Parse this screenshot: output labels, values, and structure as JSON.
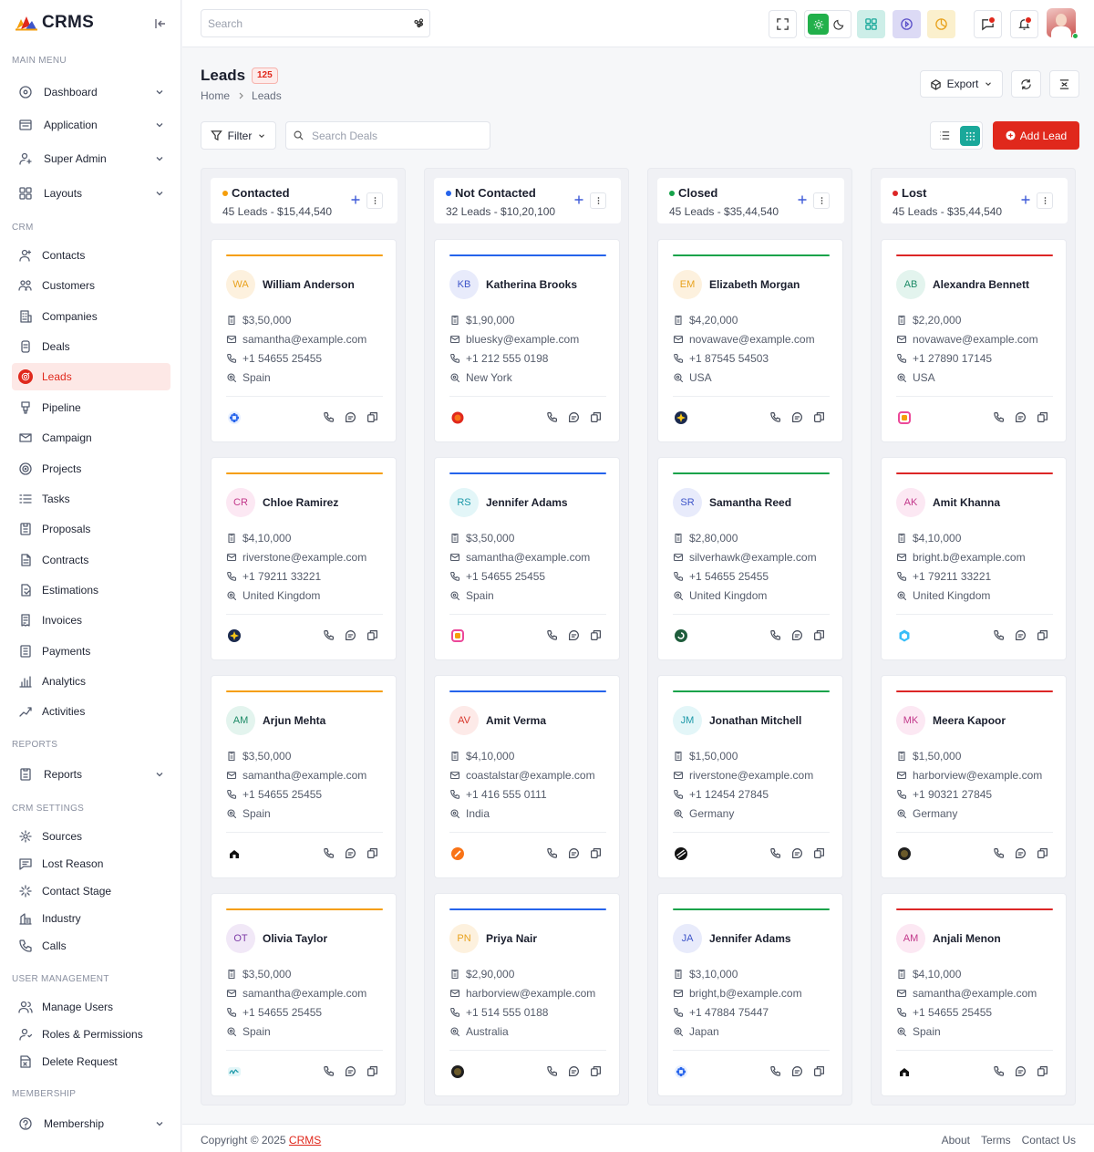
{
  "brand": {
    "name": "CRMS"
  },
  "sidebar": {
    "sections": {
      "main": "MAIN MENU",
      "crm": "CRM",
      "reports": "REPORTS",
      "settings": "CRM SETTINGS",
      "users": "USER MANAGEMENT",
      "membership": "MEMBERSHIP"
    },
    "main": [
      {
        "label": "Dashboard",
        "icon": "dashboard-icon"
      },
      {
        "label": "Application",
        "icon": "application-icon"
      },
      {
        "label": "Super Admin",
        "icon": "super-admin-icon"
      },
      {
        "label": "Layouts",
        "icon": "layouts-icon"
      }
    ],
    "crm": [
      {
        "label": "Contacts",
        "icon": "contacts-icon"
      },
      {
        "label": "Customers",
        "icon": "customers-icon"
      },
      {
        "label": "Companies",
        "icon": "companies-icon"
      },
      {
        "label": "Deals",
        "icon": "deals-icon"
      },
      {
        "label": "Leads",
        "icon": "leads-icon"
      },
      {
        "label": "Pipeline",
        "icon": "pipeline-icon"
      },
      {
        "label": "Campaign",
        "icon": "campaign-icon"
      },
      {
        "label": "Projects",
        "icon": "projects-icon"
      },
      {
        "label": "Tasks",
        "icon": "tasks-icon"
      },
      {
        "label": "Proposals",
        "icon": "proposals-icon"
      },
      {
        "label": "Contracts",
        "icon": "contracts-icon"
      },
      {
        "label": "Estimations",
        "icon": "estimations-icon"
      },
      {
        "label": "Invoices",
        "icon": "invoices-icon"
      },
      {
        "label": "Payments",
        "icon": "payments-icon"
      },
      {
        "label": "Analytics",
        "icon": "analytics-icon"
      },
      {
        "label": "Activities",
        "icon": "activities-icon"
      }
    ],
    "reports": [
      {
        "label": "Reports",
        "icon": "reports-icon"
      }
    ],
    "settings": [
      {
        "label": "Sources",
        "icon": "sources-icon"
      },
      {
        "label": "Lost Reason",
        "icon": "lost-reason-icon"
      },
      {
        "label": "Contact Stage",
        "icon": "contact-stage-icon"
      },
      {
        "label": "Industry",
        "icon": "industry-icon"
      },
      {
        "label": "Calls",
        "icon": "calls-icon"
      }
    ],
    "users": [
      {
        "label": "Manage Users",
        "icon": "manage-users-icon"
      },
      {
        "label": "Roles & Permissions",
        "icon": "roles-icon"
      },
      {
        "label": "Delete Request",
        "icon": "delete-request-icon"
      }
    ],
    "membership": [
      {
        "label": "Membership",
        "icon": "membership-icon"
      }
    ],
    "active": "Leads"
  },
  "topbar": {
    "search_placeholder": "Search"
  },
  "page": {
    "title": "Leads",
    "count": "125",
    "breadcrumb": [
      "Home",
      "Leads"
    ],
    "export_label": "Export",
    "filter_label": "Filter",
    "search_deals_placeholder": "Search Deals",
    "add_lead_label": "Add Lead"
  },
  "colors": {
    "accent": "#e0281c",
    "contacted": "#f59e0b",
    "not_contacted": "#2563eb",
    "closed": "#16a34a",
    "lost": "#dc2626"
  },
  "columns": [
    {
      "title": "Contacted",
      "color": "#f59e0b",
      "summary": "45 Leads - $15,44,540",
      "cards": [
        {
          "initials": "WA",
          "name": "William Anderson",
          "amount": "$3,50,000",
          "email": "samantha@example.com",
          "phone": "+1 54655 25455",
          "location": "Spain",
          "logo": "blue-flower-logo",
          "av_bg": "#fdf1de",
          "av_fg": "#e8a21e"
        },
        {
          "initials": "CR",
          "name": "Chloe Ramirez",
          "amount": "$4,10,000",
          "email": "riverstone@example.com",
          "phone": "+1 79211 33221",
          "location": "United Kingdom",
          "logo": "navy-star-logo",
          "av_bg": "#fce8f3",
          "av_fg": "#c2378a"
        },
        {
          "initials": "AM",
          "name": "Arjun Mehta",
          "amount": "$3,50,000",
          "email": "samantha@example.com",
          "phone": "+1 54655 25455",
          "location": "Spain",
          "logo": "black-house-logo",
          "av_bg": "#e3f4ee",
          "av_fg": "#1c8a66"
        },
        {
          "initials": "OT",
          "name": "Olivia Taylor",
          "amount": "$3,50,000",
          "email": "samantha@example.com",
          "phone": "+1 54655 25455",
          "location": "Spain",
          "logo": "teal-script-logo",
          "av_bg": "#f1e8f7",
          "av_fg": "#7c3aa6"
        }
      ]
    },
    {
      "title": "Not Contacted",
      "color": "#2563eb",
      "summary": "32 Leads - $10,20,100",
      "cards": [
        {
          "initials": "KB",
          "name": "Katherina Brooks",
          "amount": "$1,90,000",
          "email": "bluesky@example.com",
          "phone": "+1 212 555 0198",
          "location": "New York",
          "logo": "red-orange-logo",
          "av_bg": "#e8ebfb",
          "av_fg": "#3e55c9"
        },
        {
          "initials": "RS",
          "name": "Jennifer Adams",
          "amount": "$3,50,000",
          "email": "samantha@example.com",
          "phone": "+1 54655 25455",
          "location": "Spain",
          "logo": "gradient-square-logo",
          "av_bg": "#e3f6f8",
          "av_fg": "#1b98a8"
        },
        {
          "initials": "AV",
          "name": "Amit Verma",
          "amount": "$4,10,000",
          "email": "coastalstar@example.com",
          "phone": "+1 416 555 0111",
          "location": "India",
          "logo": "orange-slash-logo",
          "av_bg": "#fdeae8",
          "av_fg": "#d8382c"
        },
        {
          "initials": "PN",
          "name": "Priya Nair",
          "amount": "$2,90,000",
          "email": "harborview@example.com",
          "phone": "+1 514 555 0188",
          "location": "Australia",
          "logo": "dark-circle-logo",
          "av_bg": "#fdf1de",
          "av_fg": "#e8a21e"
        }
      ]
    },
    {
      "title": "Closed",
      "color": "#16a34a",
      "summary": "45 Leads - $35,44,540",
      "cards": [
        {
          "initials": "EM",
          "name": "Elizabeth Morgan",
          "amount": "$4,20,000",
          "email": "novawave@example.com",
          "phone": "+1 87545 54503",
          "location": "USA",
          "logo": "navy-star-logo",
          "av_bg": "#fdf1de",
          "av_fg": "#e8a21e"
        },
        {
          "initials": "SR",
          "name": "Samantha Reed",
          "amount": "$2,80,000",
          "email": "silverhawk@example.com",
          "phone": "+1 54655 25455",
          "location": "United Kingdom",
          "logo": "green-swirl-logo",
          "av_bg": "#e8ebfb",
          "av_fg": "#3e55c9"
        },
        {
          "initials": "JM",
          "name": "Jonathan Mitchell",
          "amount": "$1,50,000",
          "email": "riverstone@example.com",
          "phone": "+1 12454 27845",
          "location": "Germany",
          "logo": "black-stripe-logo",
          "av_bg": "#e3f6f8",
          "av_fg": "#1b98a8"
        },
        {
          "initials": "JA",
          "name": "Jennifer Adams",
          "amount": "$3,10,000",
          "email": "bright,b@example.com",
          "phone": "+1 47884 75447",
          "location": "Japan",
          "logo": "blue-flower-logo",
          "av_bg": "#e8ebfb",
          "av_fg": "#3e55c9"
        }
      ]
    },
    {
      "title": "Lost",
      "color": "#dc2626",
      "summary": "45 Leads - $35,44,540",
      "cards": [
        {
          "initials": "AB",
          "name": "Alexandra Bennett",
          "amount": "$2,20,000",
          "email": "novawave@example.com",
          "phone": "+1 27890 17145",
          "location": "USA",
          "logo": "gradient-square-logo",
          "av_bg": "#e3f4ee",
          "av_fg": "#1c8a66"
        },
        {
          "initials": "AK",
          "name": "Amit Khanna",
          "amount": "$4,10,000",
          "email": "bright.b@example.com",
          "phone": "+1 79211 33221",
          "location": "United Kingdom",
          "logo": "blue-hex-logo",
          "av_bg": "#fce8f3",
          "av_fg": "#c2378a"
        },
        {
          "initials": "MK",
          "name": "Meera Kapoor",
          "amount": "$1,50,000",
          "email": "harborview@example.com",
          "phone": "+1 90321 27845",
          "location": "Germany",
          "logo": "dark-circle-logo",
          "av_bg": "#fce8f3",
          "av_fg": "#c2378a"
        },
        {
          "initials": "AM",
          "name": "Anjali Menon",
          "amount": "$4,10,000",
          "email": "samantha@example.com",
          "phone": "+1 54655 25455",
          "location": "Spain",
          "logo": "black-house-logo",
          "av_bg": "#fce8f3",
          "av_fg": "#c2378a"
        }
      ]
    }
  ],
  "footer": {
    "copyright": "Copyright © 2025 ",
    "brand_link": "CRMS",
    "links": [
      "About",
      "Terms",
      "Contact Us"
    ]
  }
}
